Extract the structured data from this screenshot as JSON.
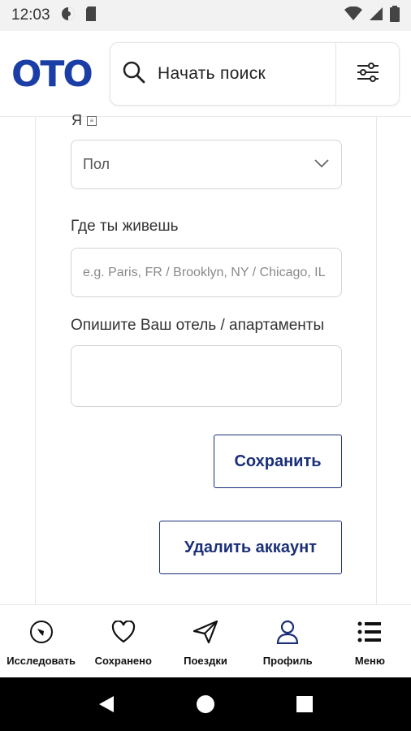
{
  "status_bar": {
    "time": "12:03",
    "left_icons": [
      "vpn-icon",
      "sd-card-icon"
    ],
    "right_icons": [
      "wifi-icon",
      "signal-icon",
      "battery-icon"
    ]
  },
  "header": {
    "logo": "OTO",
    "search_label": "Начать поиск",
    "search_icon": "search-icon",
    "filter_icon": "filter-icon"
  },
  "form": {
    "partial_label": "Я",
    "gender_select": {
      "value": "Пол"
    },
    "location": {
      "label": "Где ты живешь",
      "placeholder": "e.g. Paris, FR / Brooklyn, NY / Chicago, IL",
      "value": ""
    },
    "description": {
      "label": "Опишите Ваш отель / апартаменты",
      "value": ""
    },
    "save_label": "Сохранить",
    "delete_label": "Удалить аккаунт"
  },
  "bottom_nav": {
    "items": [
      {
        "label": "Исследовать",
        "icon": "compass-icon"
      },
      {
        "label": "Сохранено",
        "icon": "heart-icon"
      },
      {
        "label": "Поездки",
        "icon": "paper-plane-icon"
      },
      {
        "label": "Профиль",
        "icon": "user-icon"
      },
      {
        "label": "Меню",
        "icon": "menu-icon"
      }
    ]
  },
  "colors": {
    "brand": "#1a3ea6",
    "button_text": "#1a2f78"
  }
}
